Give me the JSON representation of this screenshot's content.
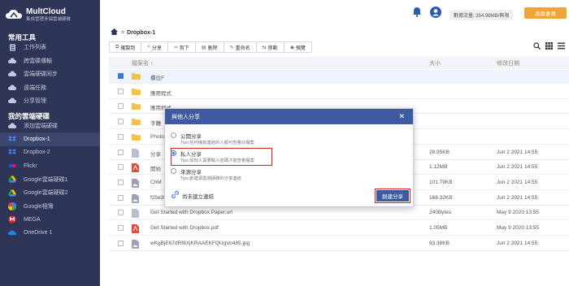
{
  "brand": {
    "name": "MultCloud",
    "tagline": "集成管理多個雲端硬碟"
  },
  "sidebar": {
    "section1": "常用工具",
    "tools": [
      {
        "label": "工作列表",
        "icon": "list-icon"
      },
      {
        "label": "跨雲碟傳輸",
        "icon": "cloud-transfer-icon"
      },
      {
        "label": "雲端硬碟同步",
        "icon": "cloud-sync-icon"
      },
      {
        "label": "遠端任務",
        "icon": "cloud-download-icon"
      },
      {
        "label": "分享管理",
        "icon": "share-icon"
      }
    ],
    "section2": "我的雲端硬碟",
    "drives": [
      {
        "label": "添加雲端硬碟",
        "icon": "add-cloud-icon"
      },
      {
        "label": "Dropbox-1",
        "icon": "dropbox-icon",
        "active": true
      },
      {
        "label": "Dropbox-2",
        "icon": "dropbox-icon"
      },
      {
        "label": "Flickr",
        "icon": "flickr-icon"
      },
      {
        "label": "Google雲端硬碟1",
        "icon": "google-drive-icon"
      },
      {
        "label": "Google雲端硬碟2",
        "icon": "google-drive-icon"
      },
      {
        "label": "Google相簿",
        "icon": "google-photos-icon"
      },
      {
        "label": "MEGA",
        "icon": "mega-icon"
      },
      {
        "label": "OneDrive 1",
        "icon": "onedrive-icon"
      }
    ]
  },
  "topbar": {
    "traffic": "數據流量: 354.98MB/無限",
    "upgrade": "高級會員"
  },
  "breadcrumb": {
    "current": "Dropbox-1"
  },
  "toolbar": [
    "複製到",
    "分享",
    "剪下",
    "刪除",
    "重命名",
    "移動",
    "預覽"
  ],
  "table": {
    "headers": {
      "name": "檔案名 ↑",
      "size": "大小",
      "date": "修改日期"
    },
    "rows": [
      {
        "name": "欄位F",
        "size": "",
        "date": "",
        "type": "folder",
        "checked": true
      },
      {
        "name": "應用程式",
        "size": "",
        "date": "",
        "type": "folder"
      },
      {
        "name": "應用程式",
        "size": "",
        "date": "",
        "type": "folder"
      },
      {
        "name": "字體",
        "size": "",
        "date": "",
        "type": "folder"
      },
      {
        "name": "Photos",
        "size": "",
        "date": "",
        "type": "folder"
      },
      {
        "name": "分享",
        "size": "28.95KB",
        "date": "Jun 2 2021 14:55",
        "type": "file"
      },
      {
        "name": "開始",
        "size": "1.12MB",
        "date": "Jun 2 2021 14:55",
        "type": "pdf"
      },
      {
        "name": "ChM",
        "size": "101.79KB",
        "date": "Jun 2 2021 14:55",
        "type": "image"
      },
      {
        "name": "f25e3f66ac3f449cb68e0586e6c2b624_1h.jpg",
        "size": "168.32KB",
        "date": "Jun 2 2021 14:55",
        "type": "image"
      },
      {
        "name": "Get Started with Dropbox Paper.url",
        "size": "240Bytes",
        "date": "May 9 2020 13:55",
        "type": "file"
      },
      {
        "name": "Get Started with Dropbox.pdf",
        "size": "1.05MB",
        "date": "May 9 2020 13:55",
        "type": "pdf"
      },
      {
        "name": "wKgBjE67dRf8XjKRAAEKFQUgVo485.jpg",
        "size": "93.38KB",
        "date": "Jun 2 2021 14:55",
        "type": "image"
      }
    ]
  },
  "dialog": {
    "title": "與他人分享",
    "options": [
      {
        "title": "公開分享",
        "tip": "Tips:任何擁有連結的人都可查看此檔案",
        "selected": false
      },
      {
        "title": "私人分享",
        "tip": "Tips:其他人需要輸入密碼才能查看檔案",
        "selected": true
      },
      {
        "title": "來源分享",
        "tip": "Tips:創建源雲端硬碟的分享連結",
        "selected": false
      }
    ],
    "link_status": "尚未建立連結",
    "create_button": "創建分享"
  },
  "colors": {
    "sidebar": "#2e3556",
    "accent": "#3f5a9e",
    "highlight": "#e02020",
    "upgrade": "#f0a33a"
  }
}
